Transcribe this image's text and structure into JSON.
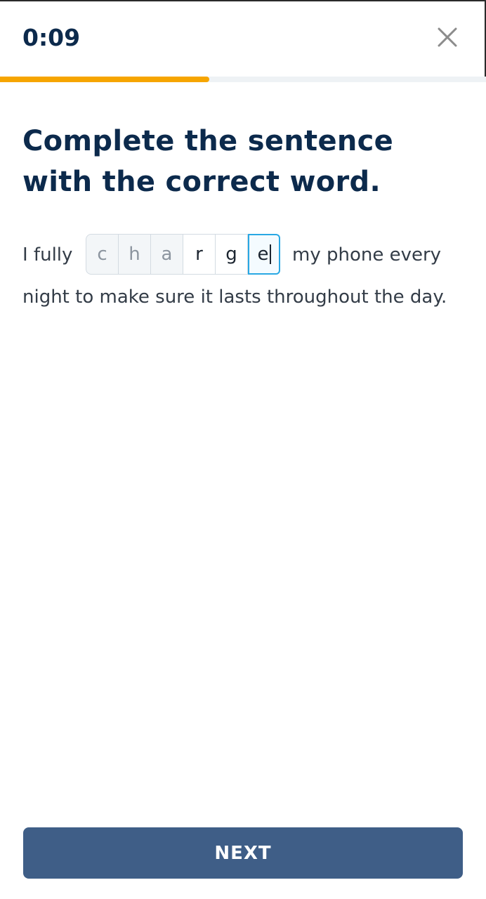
{
  "header": {
    "timer": "0:09",
    "close_icon": "close-icon",
    "progress_fraction": 0.43,
    "progress_color": "#f6a500"
  },
  "question": {
    "prompt": "Complete the sentence with the correct word.",
    "sentence_before": "I fully",
    "sentence_after_line1": "my phone every",
    "sentence_line2": "night to make sure it lasts throughout the day.",
    "answer_letters": [
      {
        "char": "c",
        "state": "hint"
      },
      {
        "char": "h",
        "state": "hint"
      },
      {
        "char": "a",
        "state": "hint"
      },
      {
        "char": "r",
        "state": "typed"
      },
      {
        "char": "g",
        "state": "typed"
      },
      {
        "char": "e",
        "state": "active"
      }
    ]
  },
  "footer": {
    "next_label": "NEXT",
    "next_color": "#3f5e87"
  }
}
